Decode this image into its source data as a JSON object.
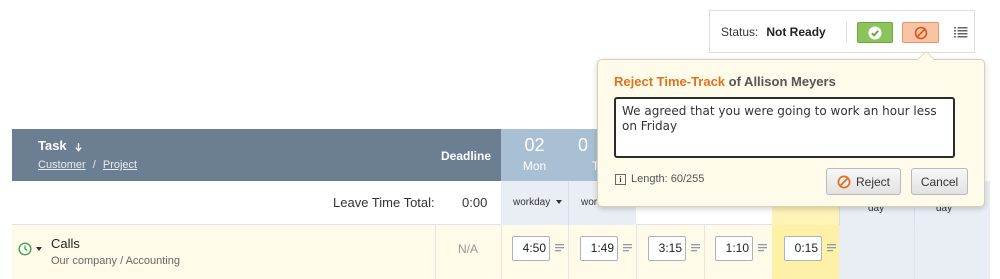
{
  "status": {
    "label": "Status:",
    "value": "Not Ready",
    "approve_icon": "check-icon",
    "reject_icon": "ban-icon",
    "list_icon": "list-icon"
  },
  "table": {
    "header": {
      "task": "Task",
      "sort_icon": "arrow-down-icon",
      "customer": "Customer",
      "separator": "/",
      "project": "Project",
      "deadline": "Deadline",
      "days": [
        {
          "num": "02",
          "name": "Mon"
        },
        {
          "num": "0",
          "name": "T"
        }
      ]
    },
    "leave": {
      "label": "Leave Time Total:",
      "value": "0:00",
      "workday_options": [
        "workday",
        "wor"
      ],
      "right_days": [
        "day",
        "day"
      ]
    },
    "row": {
      "task": "Calls",
      "sub": "Our company  /  Accounting",
      "deadline": "N/A",
      "times": [
        "4:50",
        "1:49",
        "3:15",
        "1:10",
        "0:15"
      ]
    }
  },
  "popup": {
    "title_accent": "Reject Time-Track",
    "title_rest": " of Allison Meyers",
    "comment": "We agreed that you were going to work an hour less on Friday",
    "length": "Length: 60/255",
    "reject_label": "Reject",
    "cancel_label": "Cancel"
  },
  "colors": {
    "header": "#6c7f92",
    "day_header": "#a9bfd4",
    "accent": "#e0721f",
    "approve": "#8dc35b",
    "reject": "#f8c4a4"
  }
}
